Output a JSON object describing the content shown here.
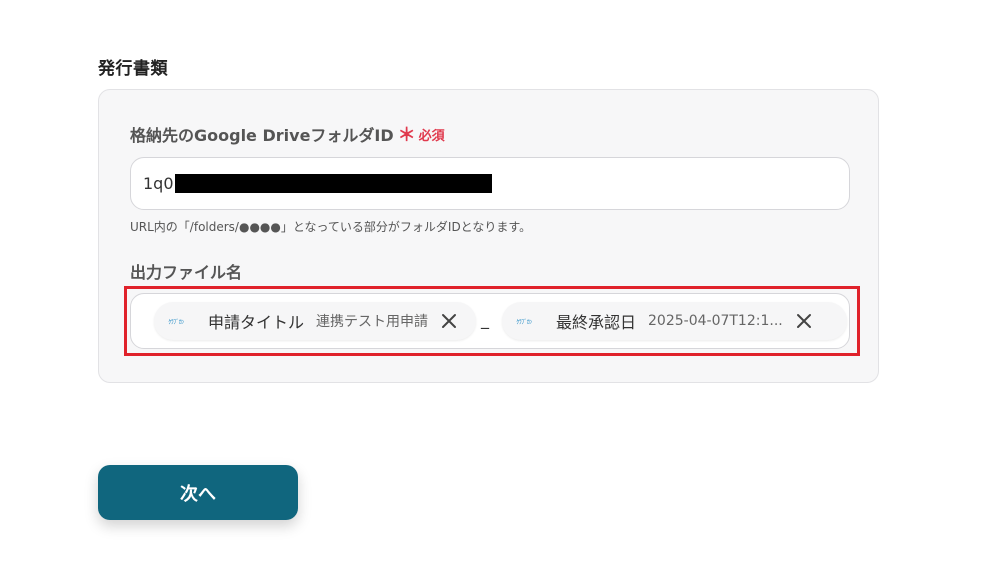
{
  "section": {
    "title": "発行書類"
  },
  "folder_field": {
    "label": "格納先のGoogle DriveフォルダID",
    "required_mark": "＊",
    "required_text": "必須",
    "value": "1q0",
    "help_text": "URL内の「/folders/●●●●」となっている部分がフォルダIDとなります。"
  },
  "filename_field": {
    "label": "出力ファイル名",
    "separator": "_",
    "chips": [
      {
        "logo": "ｸﾗﾌﾞｶﾝ",
        "name": "申請タイトル",
        "value": "連携テスト用申請",
        "icon": "close-icon"
      },
      {
        "logo": "ｸﾗﾌﾞｶﾝ",
        "name": "最終承認日",
        "value": "2025-04-07T12:1...",
        "icon": "close-icon"
      }
    ]
  },
  "next_button": {
    "label": "次へ"
  },
  "colors": {
    "primary_button": "#10667e",
    "required": "#e0394d",
    "highlight": "#e0222b"
  }
}
